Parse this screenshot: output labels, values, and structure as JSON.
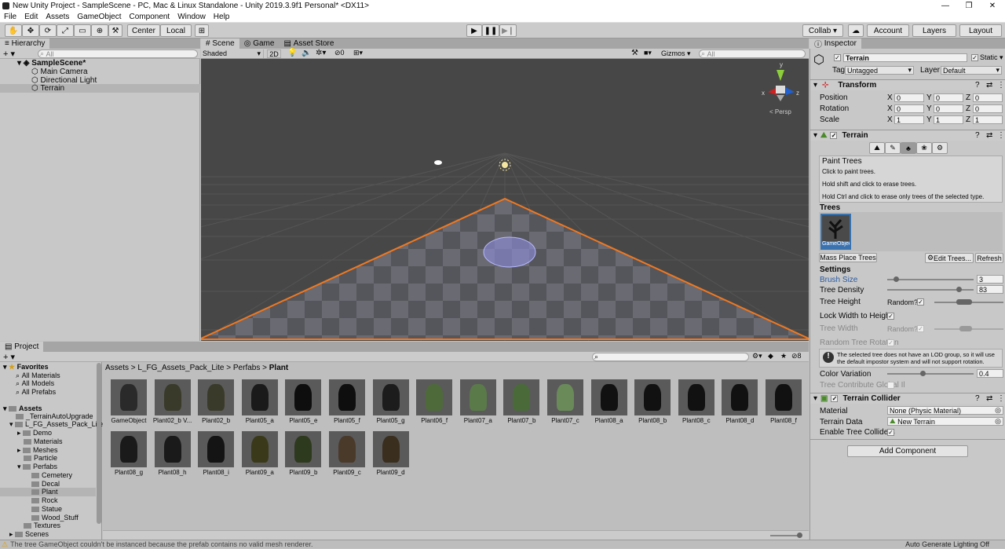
{
  "window": {
    "title": "New Unity Project - SampleScene - PC, Mac & Linux Standalone - Unity 2019.3.9f1 Personal* <DX11>",
    "min": "—",
    "max": "❐",
    "close": "✕"
  },
  "menu": [
    "File",
    "Edit",
    "Assets",
    "GameObject",
    "Component",
    "Window",
    "Help"
  ],
  "toolbar": {
    "center": "Center",
    "local": "Local",
    "collab": "Collab ▾",
    "account": "Account",
    "layers": "Layers",
    "layout": "Layout",
    "play": "▶",
    "pause": "❚❚",
    "step": "▶❙"
  },
  "hierarchy": {
    "tab": "Hierarchy",
    "search": "All",
    "scene": "SampleScene*",
    "items": [
      "Main Camera",
      "Directional Light",
      "Terrain"
    ]
  },
  "scene": {
    "tabs": [
      "Scene",
      "Game",
      "Asset Store"
    ],
    "shading": "Shaded",
    "two_d": "2D",
    "gizmos": "Gizmos",
    "search": "All",
    "persp": "< Persp",
    "fx_count": "0",
    "axes": {
      "x": "x",
      "y": "y",
      "z": "z"
    }
  },
  "project": {
    "tab": "Project",
    "breadcrumb": [
      "Assets",
      "L_FG_Assets_Pack_Lite",
      "Perfabs",
      "Plant"
    ],
    "search": "",
    "hidden_count": "8",
    "favorites": {
      "label": "Favorites",
      "items": [
        "All Materials",
        "All Models",
        "All Prefabs"
      ]
    },
    "assets": {
      "label": "Assets",
      "items": [
        "_TerrainAutoUpgrade",
        "L_FG_Assets_Pack_Lite",
        "Demo",
        "Materials",
        "Meshes",
        "Particle",
        "Perfabs",
        "Cemetery",
        "Decal",
        "Plant",
        "Rock",
        "Statue",
        "Wood_Stuff",
        "Textures"
      ]
    },
    "scenes": "Scenes",
    "files": [
      "GameObject",
      "Plant02_b V...",
      "Plant02_b",
      "Plant05_a",
      "Plant05_e",
      "Plant05_f",
      "Plant05_g",
      "Plant06_f",
      "Plant07_a",
      "Plant07_b",
      "Plant07_c",
      "Plant08_a",
      "Plant08_b",
      "Plant08_c",
      "Plant08_d",
      "Plant08_f",
      "Plant08_g",
      "Plant08_h",
      "Plant08_i",
      "Plant09_a",
      "Plant09_b",
      "Plant09_c",
      "Plant09_d"
    ]
  },
  "inspector": {
    "tab": "Inspector",
    "name": "Terrain",
    "static": "Static ▾",
    "tag_label": "Tag",
    "tag": "Untagged",
    "layer_label": "Layer",
    "layer": "Default",
    "transform": {
      "title": "Transform",
      "rows": [
        {
          "label": "Position",
          "x": "0",
          "y": "0",
          "z": "0"
        },
        {
          "label": "Rotation",
          "x": "0",
          "y": "0",
          "z": "0"
        },
        {
          "label": "Scale",
          "x": "1",
          "y": "1",
          "z": "1"
        }
      ],
      "axis": [
        "X",
        "Y",
        "Z"
      ]
    },
    "terrain": {
      "title": "Terrain",
      "paint_title": "Paint Trees",
      "help1": "Click to paint trees.",
      "help2": "Hold shift and click to erase trees.",
      "help3": "Hold Ctrl and click to erase only trees of the selected type.",
      "trees_label": "Trees",
      "tree_item": "GameObject",
      "mass_place": "Mass Place Trees",
      "edit_trees": "Edit Trees...",
      "refresh": "Refresh",
      "settings": "Settings",
      "brush_size_label": "Brush Size",
      "brush_size": "3",
      "tree_density_label": "Tree Density",
      "tree_density": "83",
      "tree_height_label": "Tree Height",
      "random": "Random?",
      "lock_label": "Lock Width to Height",
      "tree_width_label": "Tree Width",
      "random_rot_label": "Random Tree Rotation",
      "warning": "The selected tree does not have an LOD group, so it will use the default impostor system and will not support rotation.",
      "color_var_label": "Color Variation",
      "color_var": "0.4",
      "contribute_gi": "Tree Contribute Global Il",
      "brush_size_pct": 0.08,
      "tree_density_pct": 0.83,
      "color_var_pct": 0.4
    },
    "collider": {
      "title": "Terrain Collider",
      "material_label": "Material",
      "material": "None (Physic Material)",
      "data_label": "Terrain Data",
      "data": "New Terrain",
      "enable_label": "Enable Tree Colliders"
    },
    "add_component": "Add Component"
  },
  "status": {
    "message": "The tree GameObject couldn't be instanced because the prefab contains no valid mesh renderer.",
    "right": "Auto Generate Lighting Off"
  },
  "colors": {
    "selection": "#3a72b0",
    "terrain_outline": "#f07820",
    "brush": "#9090e0"
  }
}
